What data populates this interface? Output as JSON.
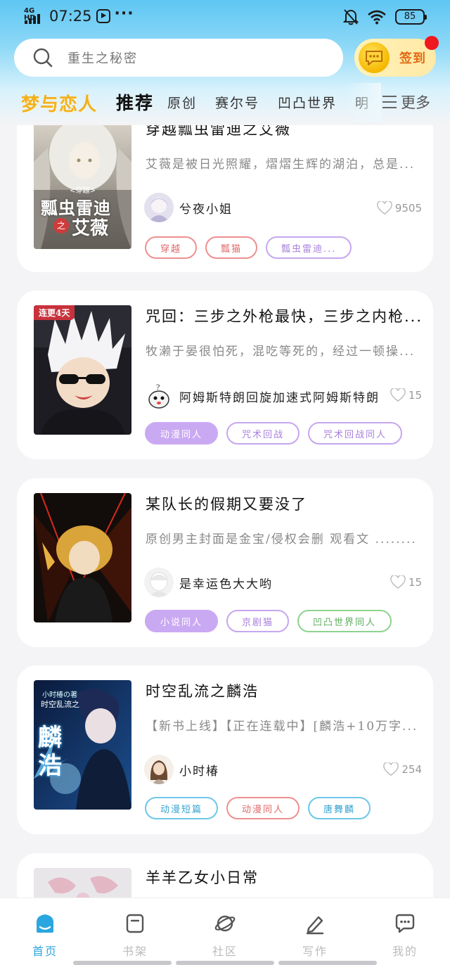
{
  "status_bar": {
    "network": "4G HD",
    "time": "07:25",
    "dots": "···",
    "battery": "85"
  },
  "search": {
    "placeholder": "重生之秘密"
  },
  "checkin": {
    "label": "签到"
  },
  "tabs": {
    "brand": "梦与恋人",
    "items": [
      "推荐",
      "原创",
      "赛尔号",
      "凹凸世界",
      "明"
    ],
    "active": "推荐",
    "more": "更多"
  },
  "feed": [
    {
      "title": "穿越瓢虫雷迪之艾薇",
      "description": "艾薇是被日光照耀，熠熠生辉的湖泊，总是...",
      "author": "兮夜小姐",
      "likes": "9505",
      "tags": [
        "穿越",
        "瓢猫",
        "瓢虫雷迪..."
      ],
      "cover_text": [
        "<穿越>",
        "瓢虫雷迪",
        "之",
        "艾薇"
      ]
    },
    {
      "title": "咒回：三步之外枪最快，三步之内枪...",
      "description": "牧濑于晏很怕死，混吃等死的，经过一顿操...",
      "author": "阿姆斯特朗回旋加速式阿姆斯特朗",
      "likes": "15",
      "tags": [
        "动漫同人",
        "咒术回战",
        "咒术回战同人"
      ],
      "badge": "连更4天"
    },
    {
      "title": "某队长的假期又要没了",
      "description": "原创男主封面是金宝/侵权会删 观看文 ........",
      "author": "是幸运色大大哟",
      "likes": "15",
      "tags": [
        "小说同人",
        "京剧猫",
        "凹凸世界同人"
      ]
    },
    {
      "title": "时空乱流之麟浩",
      "description": "【新书上线】【正在连载中】[麟浩+10万字...",
      "author": "小时椿",
      "likes": "254",
      "tags": [
        "动漫短篇",
        "动漫同人",
        "唐舞麟"
      ],
      "cover_text": [
        "小时椿の著",
        "时空乱流之",
        "麟浩"
      ]
    },
    {
      "title": "羊羊乙女小日常"
    }
  ],
  "bottom_nav": [
    {
      "label": "首页",
      "icon": "home-icon"
    },
    {
      "label": "书架",
      "icon": "bookshelf-icon"
    },
    {
      "label": "社区",
      "icon": "planet-icon"
    },
    {
      "label": "写作",
      "icon": "pen-icon"
    },
    {
      "label": "我的",
      "icon": "chat-bubble-icon"
    }
  ],
  "colors": {
    "accent": "#2aa6e0",
    "brand": "#f2b01e",
    "checkin_text": "#e06b12",
    "notification_dot": "#f0171f"
  }
}
